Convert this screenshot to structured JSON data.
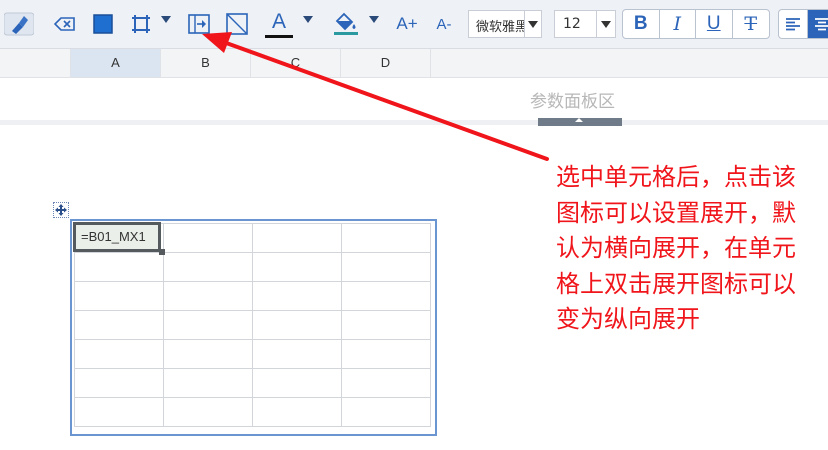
{
  "toolbar": {
    "font_family": "微软雅黑",
    "font_size": "12",
    "bold": "B",
    "italic": "I",
    "underline": "U",
    "strikethrough": "T",
    "font_color_label": "A",
    "grow_font": "A+",
    "shrink_font": "A-"
  },
  "columns": [
    "A",
    "B",
    "C",
    "D"
  ],
  "param_panel": {
    "title": "参数面板区"
  },
  "cell": {
    "formula": "=B01_MX1"
  },
  "annotation": {
    "lines": [
      "选中单元格后，点击该",
      "图标可以设置展开，默",
      "认为横向展开，在单元",
      "格上双击展开图标可以",
      "变为纵向展开"
    ]
  },
  "colors": {
    "accent": "#2b64b8",
    "annotation": "#f0151b",
    "selection_border": "#6b95d0"
  }
}
